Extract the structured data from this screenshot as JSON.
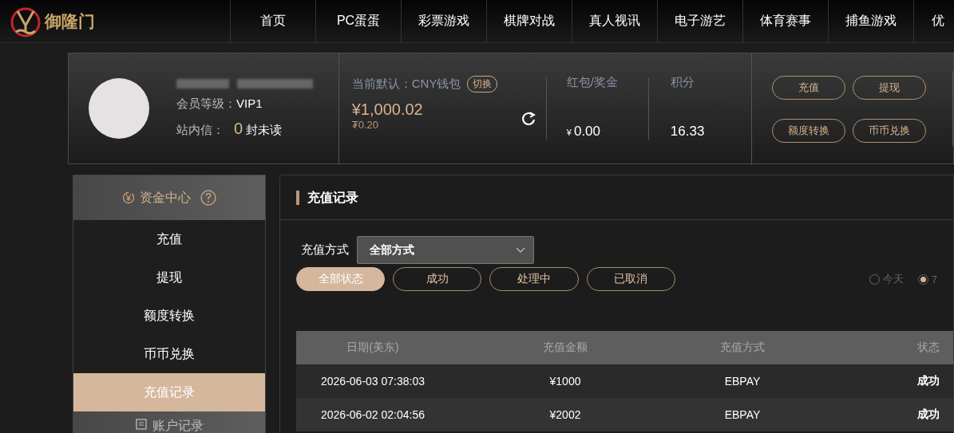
{
  "header": {
    "logo_text": "御隆门",
    "nav": [
      {
        "label": "首页"
      },
      {
        "label": "PC蛋蛋"
      },
      {
        "label": "彩票游戏"
      },
      {
        "label": "棋牌对战"
      },
      {
        "label": "真人视讯"
      },
      {
        "label": "电子游艺"
      },
      {
        "label": "体育赛事"
      },
      {
        "label": "捕鱼游戏"
      },
      {
        "label": "优"
      }
    ]
  },
  "profile": {
    "level_label": "会员等级：",
    "level": "VIP1",
    "mail_label": "站内信：",
    "unread_count": "0",
    "unread_suffix": "封未读",
    "wallet_label": "当前默认：CNY钱包",
    "switch_button": "切换",
    "balance": "¥1,000.02",
    "sub_balance": "₮0.20",
    "stats": [
      {
        "label": "红包/奖金",
        "currency": "¥",
        "value": "0.00"
      },
      {
        "label": "积分",
        "value": "16.33"
      }
    ],
    "actions": [
      "充值",
      "提现",
      "额度转换",
      "币币兑换"
    ]
  },
  "sidebar": {
    "groups": [
      {
        "title": "资金中心",
        "items": [
          {
            "label": "充值",
            "selected": false
          },
          {
            "label": "提现",
            "selected": false
          },
          {
            "label": "额度转换",
            "selected": false
          },
          {
            "label": "币币兑换",
            "selected": false
          },
          {
            "label": "充值记录",
            "selected": true
          }
        ]
      },
      {
        "title": "账户记录"
      }
    ]
  },
  "panel": {
    "title": "充值记录",
    "method_label": "充值方式",
    "method_select": "全部方式",
    "status_filters": [
      {
        "label": "全部状态",
        "selected": true
      },
      {
        "label": "成功",
        "selected": false
      },
      {
        "label": "处理中",
        "selected": false
      },
      {
        "label": "已取消",
        "selected": false
      }
    ],
    "date_ranges": [
      {
        "label": "今天",
        "selected": false
      },
      {
        "label": "7",
        "selected": true
      }
    ],
    "table": {
      "columns": [
        "日期(美东)",
        "充值金额",
        "充值方式",
        "状态"
      ],
      "rows": [
        [
          "2026-06-03 07:38:03",
          "¥1000",
          "EBPAY",
          "成功"
        ],
        [
          "2026-06-02 02:04:56",
          "¥2002",
          "EBPAY",
          "成功"
        ]
      ]
    }
  }
}
